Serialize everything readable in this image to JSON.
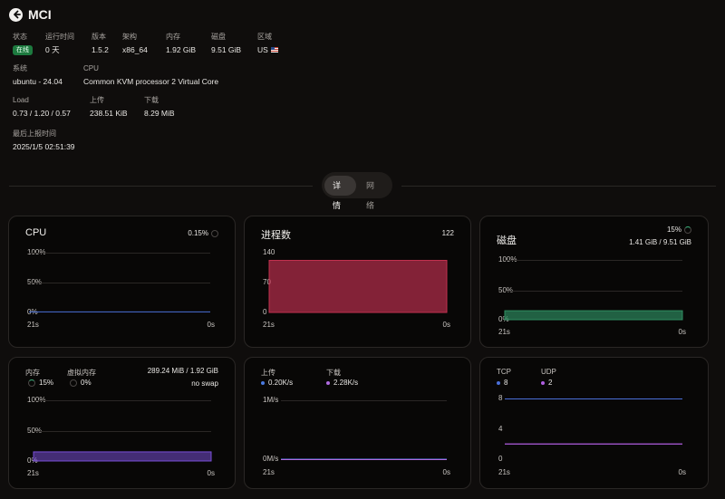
{
  "header": {
    "title": "MCI"
  },
  "info": {
    "status_label": "状态",
    "status_value": "在线",
    "uptime_label": "运行时间",
    "uptime_value": "0 天",
    "version_label": "版本",
    "version_value": "1.5.2",
    "arch_label": "架构",
    "arch_value": "x86_64",
    "memory_label": "内存",
    "memory_value": "1.92 GiB",
    "disk_label": "磁盘",
    "disk_value": "9.51 GiB",
    "region_label": "区域",
    "region_value": "US",
    "system_label": "系统",
    "system_value": "ubuntu - 24.04",
    "cpu_label": "CPU",
    "cpu_value": "Common KVM processor 2 Virtual Core",
    "load_label": "Load",
    "load_value": "0.73 / 1.20 / 0.57",
    "upload_label": "上传",
    "upload_value": "238.51 KiB",
    "download_label": "下载",
    "download_value": "8.29 MiB",
    "last_report_label": "最后上报时间",
    "last_report_value": "2025/1/5 02:51:39"
  },
  "tabs": [
    {
      "label": "详情",
      "active": true
    },
    {
      "label": "网络",
      "active": false
    }
  ],
  "colors": {
    "cpu": "#4a6fd8",
    "process": "#c2304f",
    "disk": "#2f8f62",
    "memory": "#7a4fd8",
    "upload": "#4a7ae0",
    "download": "#b06be0",
    "tcp": "#4a6fd8",
    "udp": "#b05ee0"
  },
  "cards": {
    "cpu": {
      "title": "CPU",
      "value": "0.15%",
      "percent": 0.15,
      "yticks": [
        "100%",
        "50%",
        "0%"
      ],
      "t_start": "21s",
      "t_end": "0s"
    },
    "process": {
      "title": "进程数",
      "value": "122",
      "count": 122,
      "ymax": 140,
      "yticks": [
        "140",
        "70",
        "0"
      ],
      "t_start": "21s",
      "t_end": "0s"
    },
    "disk": {
      "title": "磁盘",
      "percent_text": "15%",
      "usage_text": "1.41 GiB / 9.51 GiB",
      "percent": 15,
      "yticks": [
        "100%",
        "50%",
        "0%"
      ],
      "t_start": "21s",
      "t_end": "0s"
    },
    "memory": {
      "mem_label": "内存",
      "mem_percent_text": "15%",
      "mem_percent": 15,
      "swap_label": "虚拟内存",
      "swap_percent_text": "0%",
      "usage_text": "289.24 MiB / 1.92 GiB",
      "swap_text": "no swap",
      "yticks": [
        "100%",
        "50%",
        "0%"
      ],
      "t_start": "21s",
      "t_end": "0s"
    },
    "network": {
      "upload_label": "上传",
      "upload_value": "0.20K/s",
      "download_label": "下载",
      "download_value": "2.28K/s",
      "yticks": [
        "1M/s",
        "0M/s"
      ],
      "t_start": "21s",
      "t_end": "0s"
    },
    "connections": {
      "tcp_label": "TCP",
      "tcp_value": "8",
      "tcp": 8,
      "udp_label": "UDP",
      "udp_value": "2",
      "udp": 2,
      "ymax": 8,
      "yticks": [
        "8",
        "4",
        "0"
      ],
      "t_start": "21s",
      "t_end": "0s"
    }
  }
}
